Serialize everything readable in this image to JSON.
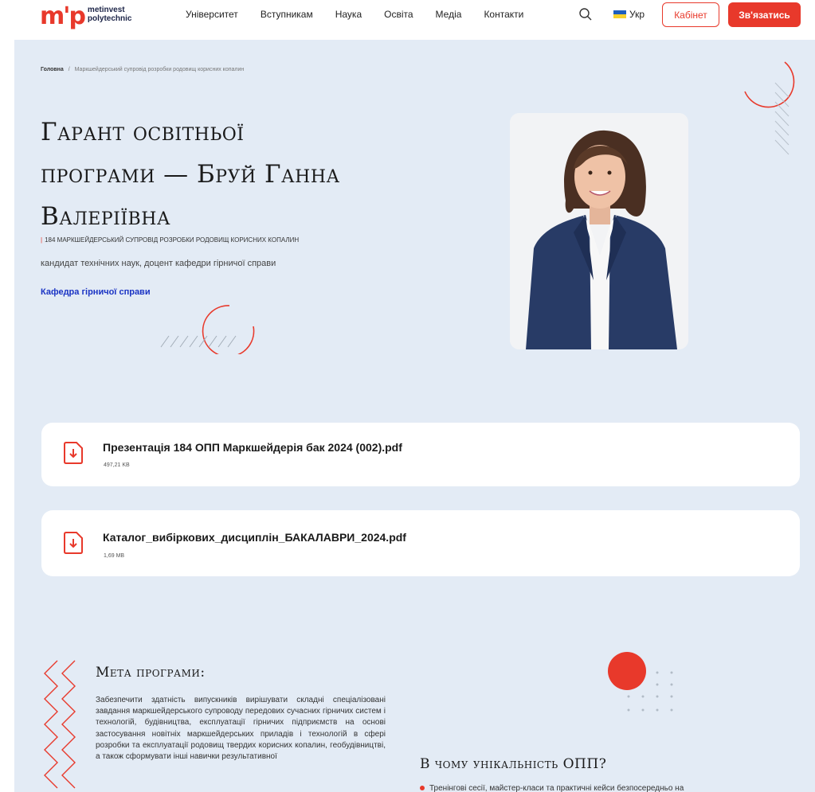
{
  "header": {
    "logo_mark": "m'p",
    "logo_line1": "metinvest",
    "logo_line2": "polytechnic",
    "nav": [
      "Університет",
      "Вступникам",
      "Наука",
      "Освіта",
      "Медіа",
      "Контакти"
    ],
    "lang": "Укр",
    "cabinet_label": "Кабінет",
    "contact_label": "Зв'язатись"
  },
  "breadcrumb": {
    "home": "Головна",
    "separator": "/",
    "current": "Маркшейдерський супровід розробки родовищ корисних копалин"
  },
  "hero": {
    "title_line1": "Гарант освітньої",
    "title_line2": "програми — Бруй Ганна",
    "title_line3": "Валеріївна",
    "program_marker": "|",
    "program": "184 маркшейдерський супровід розробки родовищ корисних копалин",
    "degree": "кандидат технічних наук, доцент кафедри гірничої справи",
    "department_link": "Кафедра гірничої справи"
  },
  "files": [
    {
      "name": "Презентація 184 ОПП Маркшейдерія бак 2024 (002).pdf",
      "size": "497,21 KB"
    },
    {
      "name": "Каталог_вибіркових_дисциплін_БАКАЛАВРИ_2024.pdf",
      "size": "1,69 MB"
    }
  ],
  "goal": {
    "title": "Мета програми:",
    "text": "Забезпечити здатність випускників вирішувати складні спеціалізовані завдання маркшейдерського супроводу передових сучасних гірничих систем і технологій, будівництва, експлуатації гірничих підприємств на основі застосування новітніх маркшейдерських приладів і технологій в сфері розробки та експлуатації родовищ твердих корисних копалин, геобудівництві, а також сформувати інші навички результативної"
  },
  "unique": {
    "title": "В чому унікальність ОПП?",
    "first_item": "Тренінгові сесії, майстер-класи та практичні кейси безпосередньо на"
  },
  "colors": {
    "accent": "#e8392b",
    "hero_bg": "#e3ebf5",
    "link": "#1a33c4"
  }
}
